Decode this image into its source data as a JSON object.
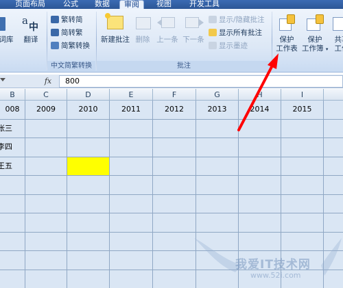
{
  "tabs": [
    "页面布局",
    "公式",
    "数据",
    "审阅",
    "视图",
    "开发工具"
  ],
  "active_tab": "审阅",
  "ribbon": {
    "proofing": {
      "thesaurus_label": "词库",
      "translate_label": "翻译"
    },
    "chinese_conversion": {
      "to_traditional": "繁转简",
      "to_simplified": "简转繁",
      "conversion": "简繁转换",
      "group_title": "中文简繁转换"
    },
    "comments": {
      "new_comment": "新建批注",
      "delete": "删除",
      "previous": "上一条",
      "next": "下一条",
      "show_hide": "显示/隐藏批注",
      "show_all": "显示所有批注",
      "show_ink": "显示墨迹",
      "group_title": "批注"
    },
    "changes": {
      "protect_sheet_line1": "保护",
      "protect_sheet_line2": "工作表",
      "protect_workbook_line1": "保护",
      "protect_workbook_line2": "工作簿",
      "share_line1": "共享",
      "share_line2": "工作"
    }
  },
  "formula_bar": {
    "fx": "fx",
    "value": "800"
  },
  "columns": [
    "B",
    "C",
    "D",
    "E",
    "F",
    "G",
    "H",
    "I"
  ],
  "year_row": [
    "008",
    "2009",
    "2010",
    "2011",
    "2012",
    "2013",
    "2014",
    "2015"
  ],
  "names": [
    "张三",
    "李四",
    "王五"
  ],
  "watermark": {
    "text": "我爱IT技术网",
    "url": "www.52i.com"
  },
  "colors": {
    "highlight": "#ffff00",
    "arrow": "#ff0000",
    "grid_bg": "#dae6f4"
  }
}
